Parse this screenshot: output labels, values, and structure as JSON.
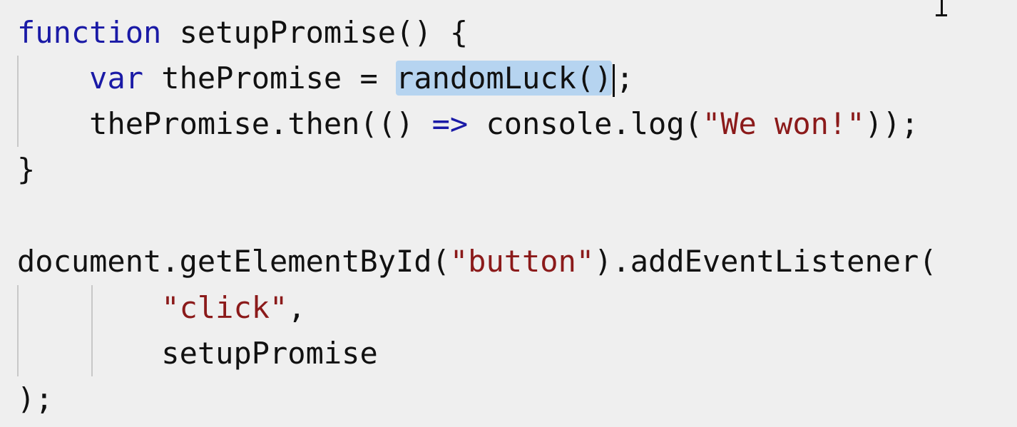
{
  "code": {
    "line1": {
      "keyword": "function",
      "name": " setupPromise() {"
    },
    "line2": {
      "indent": "    ",
      "keyword": "var",
      "before_sel": " thePromise = ",
      "selected": "randomLuck()",
      "after": ";"
    },
    "line3": {
      "indent": "    ",
      "a": "thePromise.then(() ",
      "arrow": "=>",
      "b": " console.log(",
      "string": "\"We won!\"",
      "c": "));"
    },
    "line4": {
      "text": "}"
    },
    "line6": {
      "a": "document.getElementById(",
      "string": "\"button\"",
      "b": ").addEventListener("
    },
    "line7": {
      "indent": "        ",
      "string": "\"click\"",
      "b": ","
    },
    "line8": {
      "indent": "        ",
      "text": "setupPromise"
    },
    "line9": {
      "text": ");"
    }
  },
  "colors": {
    "keyword": "#1a1aa6",
    "string": "#8b1a1a",
    "selection": "#b6d4f0",
    "background": "#efefef"
  },
  "cursor_icon": "i-beam-cursor-icon"
}
